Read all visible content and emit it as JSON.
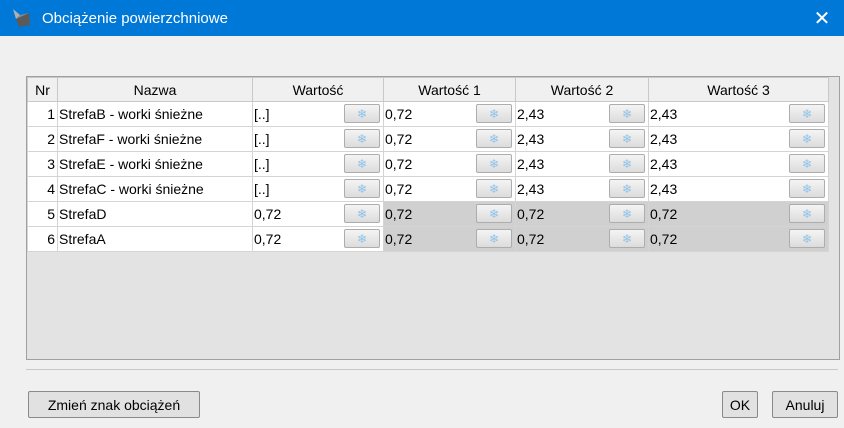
{
  "window": {
    "title": "Obciążenie powierzchniowe",
    "close_glyph": "✕"
  },
  "grid": {
    "headers": [
      "Nr",
      "Nazwa",
      "Wartość",
      "Wartość 1",
      "Wartość 2",
      "Wartość 3"
    ],
    "rows": [
      {
        "nr": "1",
        "name": "StrefaB - worki śnieżne",
        "values": [
          "[..]",
          "0,72",
          "2,43",
          "2,43"
        ],
        "gray": [
          false,
          false,
          false,
          false
        ]
      },
      {
        "nr": "2",
        "name": "StrefaF - worki śnieżne",
        "values": [
          "[..]",
          "0,72",
          "2,43",
          "2,43"
        ],
        "gray": [
          false,
          false,
          false,
          false
        ]
      },
      {
        "nr": "3",
        "name": "StrefaE - worki śnieżne",
        "values": [
          "[..]",
          "0,72",
          "2,43",
          "2,43"
        ],
        "gray": [
          false,
          false,
          false,
          false
        ]
      },
      {
        "nr": "4",
        "name": "StrefaC - worki śnieżne",
        "values": [
          "[..]",
          "0,72",
          "2,43",
          "2,43"
        ],
        "gray": [
          false,
          false,
          false,
          false
        ]
      },
      {
        "nr": "5",
        "name": "StrefaD",
        "values": [
          "0,72",
          "0,72",
          "0,72",
          "0,72"
        ],
        "gray": [
          false,
          true,
          true,
          true
        ]
      },
      {
        "nr": "6",
        "name": "StrefaA",
        "values": [
          "0,72",
          "0,72",
          "0,72",
          "0,72"
        ],
        "gray": [
          false,
          true,
          true,
          true
        ]
      }
    ],
    "cell_button_icon": "snowflake-icon",
    "cell_button_glyph": "❄"
  },
  "buttons": {
    "change_sign": "Zmień znak obciążeń",
    "ok": "OK",
    "cancel": "Anuluj"
  },
  "colors": {
    "titlebar": "#0078d7",
    "disabled_cell": "#d0d0d0"
  }
}
